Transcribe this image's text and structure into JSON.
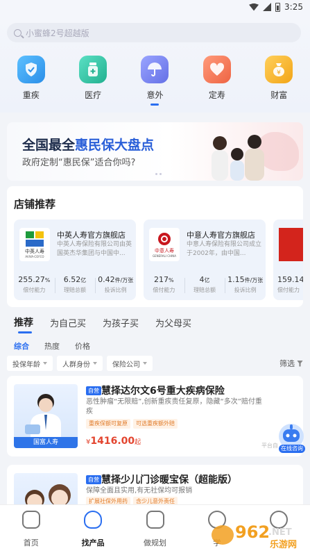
{
  "status_bar": {
    "time": "3:25"
  },
  "search": {
    "placeholder": "小蜜蜂2号超越版"
  },
  "categories": [
    {
      "label": "重疾",
      "icon": "shield-icon",
      "color": "#36a8f2"
    },
    {
      "label": "医疗",
      "icon": "medicine-bottle-icon",
      "color": "#2fc6a8"
    },
    {
      "label": "意外",
      "icon": "umbrella-icon",
      "color": "#7b86f0"
    },
    {
      "label": "定寿",
      "icon": "heart-icon",
      "color": "#f57d5d"
    },
    {
      "label": "财富",
      "icon": "money-bag-icon",
      "color": "#f5b22e"
    }
  ],
  "banner": {
    "title_prefix": "全国最全",
    "title_highlight": "惠民保大盘点",
    "subtitle": "政府定制“惠民保”适合你吗?"
  },
  "stores": {
    "title": "店铺推荐",
    "items": [
      {
        "name": "中英人寿官方旗舰店",
        "desc": "中英人寿保险有限公司由英国英杰华集团与中国中...",
        "logo_text": "中英人寿",
        "logo_sub": "AVIVA-COFCO",
        "stats": [
          {
            "value": "255.27",
            "unit": "%",
            "label": "偿付能力"
          },
          {
            "value": "6.52",
            "unit": "亿",
            "label": "理赔总额"
          },
          {
            "value": "0.42",
            "unit": "件/万张",
            "label": "投诉比例"
          }
        ]
      },
      {
        "name": "中意人寿官方旗舰店",
        "desc": "中意人寿保险有限公司成立于2002年，由中国...",
        "logo_text": "中意人寿",
        "logo_sub": "GENERALI CHINA",
        "stats": [
          {
            "value": "217",
            "unit": "%",
            "label": "偿付能力"
          },
          {
            "value": "4",
            "unit": "亿",
            "label": "理赔总额"
          },
          {
            "value": "1.15",
            "unit": "件/万张",
            "label": "投诉比例"
          }
        ]
      },
      {
        "stats": [
          {
            "value": "159.14",
            "unit": "%",
            "label": "偿付能力"
          }
        ]
      }
    ]
  },
  "tabs": [
    "推荐",
    "为自己买",
    "为孩子买",
    "为父母买"
  ],
  "sort_tabs": [
    "综合",
    "热度",
    "价格"
  ],
  "filters": [
    "投保年龄",
    "人群身份",
    "保险公司"
  ],
  "filter_button": "筛选",
  "products": [
    {
      "tag": "自营",
      "title": "慧择达尔文6号重大疾病保险",
      "desc": "恶性肿瘤“无限赔”,创新重疾责任复原，隐藏“多次”赔付重疾",
      "labels": [
        "重疾保额可复原",
        "可选重疾额外赔"
      ],
      "price_symbol": "¥",
      "price": "1416.00",
      "price_unit": "起",
      "brand": "国富人寿"
    },
    {
      "tag": "自营",
      "title": "慧择少儿门诊暖宝保（超能版）",
      "desc": "保障全面且实用,有无社保均可报销",
      "labels": [
        "扩展社保外用药",
        "含少儿意外责任"
      ]
    }
  ],
  "cs_badge": {
    "text": "在线咨询",
    "note": "平台自"
  },
  "bottom_nav": [
    {
      "label": "首页",
      "icon": "home-bear-icon"
    },
    {
      "label": "找产品",
      "icon": "shield-user-icon"
    },
    {
      "label": "做规划",
      "icon": "clipboard-check-icon"
    },
    {
      "label": "学",
      "icon": "book-icon"
    },
    {
      "label": "",
      "icon": "profile-icon"
    }
  ],
  "watermark": {
    "text1": "962",
    "text2": ".NET",
    "text3": "乐游网"
  }
}
